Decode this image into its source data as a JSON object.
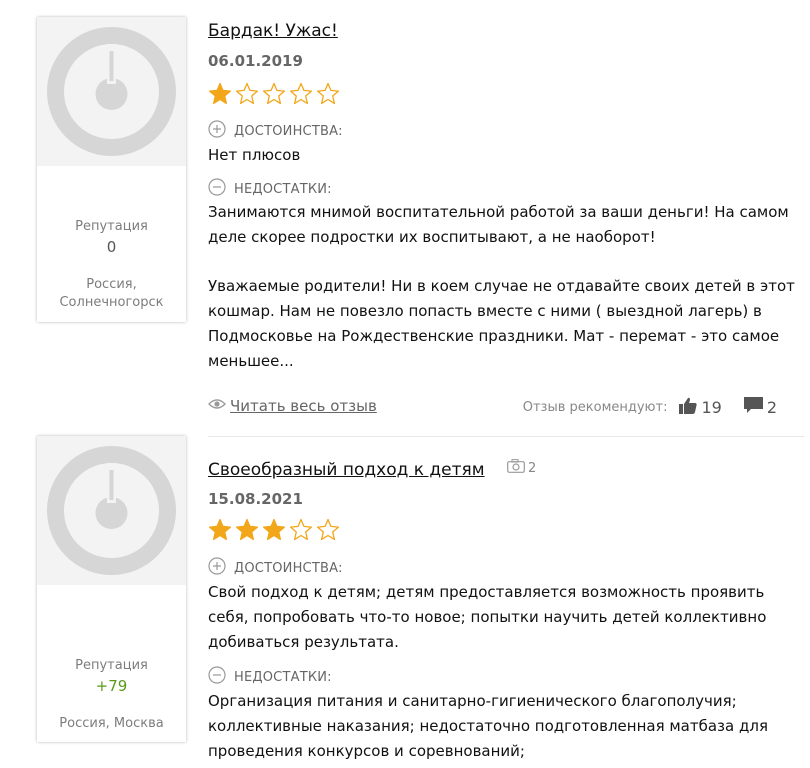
{
  "reviews": [
    {
      "title": "Бардак! Ужас!",
      "date": "06.01.2019",
      "rating": 1,
      "max_rating": 5,
      "pros_label": "ДОСТОИНСТВА:",
      "pros_text": "Нет плюсов",
      "cons_label": "НЕДОСТАТКИ:",
      "cons_text": "Занимаются мнимой воспитательной работой за ваши деньги! На самом деле скорее подростки их воспитывают, а не наоборот!",
      "body_text": "Уважаемые родители! Ни в коем случае не отдавайте своих детей в этот кошмар. Нам не повезло попасть вместе с ними ( выездной лагерь) в Подмосковье на Рождественские праздники. Мат - перемат - это самое меньшее...",
      "read_more": "Читать весь отзыв",
      "recommend_label": "Отзыв рекомендуют:",
      "likes": "19",
      "comments": "2",
      "author": {
        "reputation_label": "Репутация",
        "reputation": "0",
        "location": "Россия, Солнечногорск"
      }
    },
    {
      "title": "Своеобразный подход к детям",
      "photo_count": "2",
      "date": "15.08.2021",
      "rating": 3,
      "max_rating": 5,
      "pros_label": "ДОСТОИНСТВА:",
      "pros_text": "Свой подход к детям; детям предоставляется возможность проявить себя, попробовать что-то новое; попытки научить детей коллективно добиваться результата.",
      "cons_label": "НЕДОСТАТКИ:",
      "cons_text": "Организация питания и санитарно-гигиенического благополучия; коллективные наказания; недостаточно подготовленная матбаза для проведения конкурсов и соревнований;",
      "author": {
        "reputation_label": "Репутация",
        "reputation": "+79",
        "location": "Россия, Москва"
      }
    }
  ],
  "colors": {
    "star_filled": "#f2a619",
    "star_empty": "#f2a619",
    "reputation_positive": "#5a9a1a",
    "reputation_neutral": "#555555",
    "avatar_bg": "#f3f3f3",
    "avatar_fg": "#d6d6d6"
  },
  "icons": {
    "avatar": "default-avatar-icon",
    "pros": "plus-circle-icon",
    "cons": "minus-circle-icon",
    "read_more": "eye-icon",
    "likes": "thumbs-up-icon",
    "comments": "comment-icon",
    "photos": "camera-icon"
  }
}
